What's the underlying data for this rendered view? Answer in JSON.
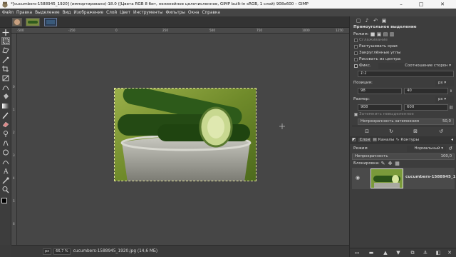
{
  "window": {
    "title": "*[cucumbers-1588945_1920] (импортировано)-18.0 ([Цвета RGB 8 бит, нелинейное целочисленное, GIMP built-in sRGB, 1 слой) 908x600 – GIMP",
    "minimize": "–",
    "maximize": "□",
    "close": "✕"
  },
  "menu": [
    "Файл",
    "Правка",
    "Выделение",
    "Вид",
    "Изображение",
    "Слой",
    "Цвет",
    "Инструменты",
    "Фильтры",
    "Окна",
    "Справка"
  ],
  "rulers": {
    "top": [
      "-500",
      "-250",
      "0",
      "250",
      "500",
      "750",
      "1000",
      "1250"
    ],
    "left": [
      "0",
      "1",
      "2",
      "3",
      "4",
      "5",
      "6"
    ]
  },
  "status": {
    "unit": "px",
    "zoom": "66,7 %",
    "file": "cucumbers-1588945_1920.jpg (14,6 МБ)"
  },
  "tool_options": {
    "title": "Прямоугольное выделение",
    "mode_label": "Режим:",
    "antialias": "Сглаживание",
    "feather": "Растушевать края",
    "rounded": "Закруглённые углы",
    "from_center": "Рисовать из центра",
    "fixed_label": "Фикс.",
    "fixed_value": "Соотношение сторон",
    "ratio": "1:1",
    "position_label": "Позиция:",
    "position_unit": "px",
    "pos_x": "98",
    "pos_y": "40",
    "size_label": "Размер:",
    "size_unit": "px",
    "width": "908",
    "height": "600",
    "highlight": "Затемнить невыделенное",
    "opacity_label": "Непрозрачность затемнения",
    "opacity_value": "50,0"
  },
  "layers": {
    "tabs": [
      "Слои",
      "Каналы",
      "Контуры"
    ],
    "mode_label": "Режим",
    "mode_value": "Нормальный",
    "opacity_label": "Непрозрачность",
    "opacity_value": "100,0",
    "lock_label": "Блокировка:",
    "layer_name": "cucumbers-1588945_19"
  }
}
